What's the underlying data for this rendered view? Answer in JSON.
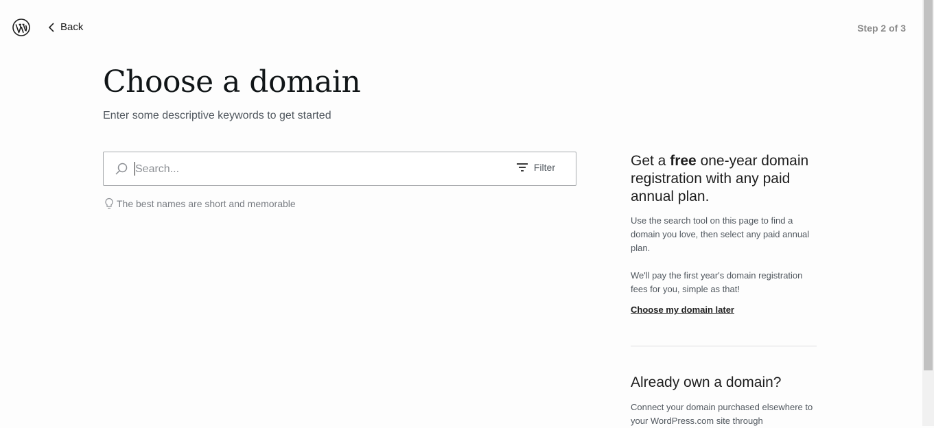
{
  "header": {
    "logo_icon": "wordpress-logo-icon",
    "back_label": "Back",
    "step": "Step 2 of 3"
  },
  "main": {
    "title": "Choose a domain",
    "subtitle": "Enter some descriptive keywords to get started",
    "search": {
      "placeholder": "Search...",
      "value": "",
      "filter_label": "Filter"
    },
    "tip": "The best names are short and memorable"
  },
  "sidebar": {
    "promo_prefix": "Get a ",
    "promo_bold": "free",
    "promo_suffix": " one-year domain registration with any paid annual plan.",
    "promo_p1": "Use the search tool on this page to find a domain you love, then select any paid annual plan.",
    "promo_p2": "We'll pay the first year's domain registration fees for you, simple as that!",
    "later_link": "Choose my domain later",
    "own_title": "Already own a domain?",
    "own_text": "Connect your domain purchased elsewhere to your WordPress.com site through"
  },
  "colors": {
    "text": "#1e1e1e",
    "muted": "#50575e",
    "border": "#a7aaad"
  }
}
